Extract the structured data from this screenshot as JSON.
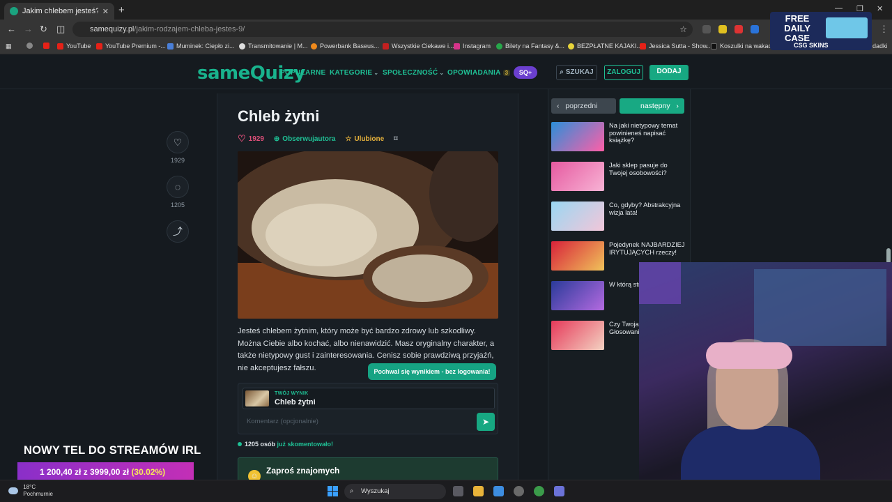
{
  "browser": {
    "tab_title": "Jakim chlebem jesteś? | sameQ",
    "address_host": "samequizy.pl",
    "address_path": "/jakim-rodzajem-chleba-jestes-9/",
    "bookmarks": [
      "YouTube",
      "YouTube Premium -...",
      "Muminek: Ciepło zi...",
      "Transmitowanie | M...",
      "Powerbank Baseus...",
      "Wszystkie Ciekawe i...",
      "Instagram",
      "Bilety na Fantasy &...",
      "BEZPŁATNE KAJAKI...",
      "Jessica Sutta - Show...",
      "Koszulki na wakacje...",
      "dadki"
    ]
  },
  "promo": {
    "line1": "FREE DAILY CASE",
    "line2": "CSG SKINS"
  },
  "header": {
    "logo_a": "same",
    "logo_b": "Q",
    "logo_c": "uizy",
    "nav": [
      "POPULARNE",
      "KATEGORIE",
      "SPOŁECZNOŚĆ",
      "OPOWIADANIA"
    ],
    "stories_badge": "3",
    "sq_label": "SQ+",
    "search_label": "SZUKAJ",
    "login_label": "ZALOGUJ",
    "add_label": "DODAJ"
  },
  "rail": {
    "likes": "1929",
    "comments": "1205"
  },
  "article": {
    "title": "Chleb żytni",
    "likes": "1929",
    "follow_label": "Obserwujautora",
    "fav_label": "Ulubione",
    "description": "Jesteś chlebem żytnim, który może być bardzo zdrowy lub szkodliwy. Można Ciebie albo kochać, albo nienawidzić. Masz oryginalny charakter, a także nietypowy gust i zainteresowania. Cenisz sobie prawdziwą przyjaźń, nie akceptujesz fałszu.",
    "share_tip": "Pochwal się wynikiem - bez logowania!",
    "result_label": "TWÓJ WYNIK",
    "result_value": "Chleb żytni",
    "comment_placeholder": "Komentarz (opcjonalnie)",
    "commented_count": "1205 osób",
    "commented_suffix": "już skomentowało!",
    "invite_title": "Zaproś znajomych"
  },
  "sidebar": {
    "prev_label": "poprzedni",
    "next_label": "następny",
    "items": [
      {
        "text": "Na jaki nietypowy temat powinieneś napisać książkę?"
      },
      {
        "text": "Jaki sklep pasuje do Twojej osobowości?"
      },
      {
        "text": "Co, gdyby? Abstrakcyjna wizja lata!"
      },
      {
        "text": "Pojedynek NAJBARDZIEJ IRYTUJĄCYCH rzeczy!"
      },
      {
        "text": "W którą str Twoje życi"
      },
      {
        "text": "Czy Twoja narzekała Głosowani"
      }
    ]
  },
  "overlay": {
    "headline": "NOWY TEL DO STREAMÓW IRL",
    "progress_text": "1 200,40 zł z 3999,00 zł",
    "progress_pct": "(30.02%)"
  },
  "taskbar": {
    "temp": "18°C",
    "weather": "Pochmurnie",
    "search": "Wyszukaj"
  }
}
